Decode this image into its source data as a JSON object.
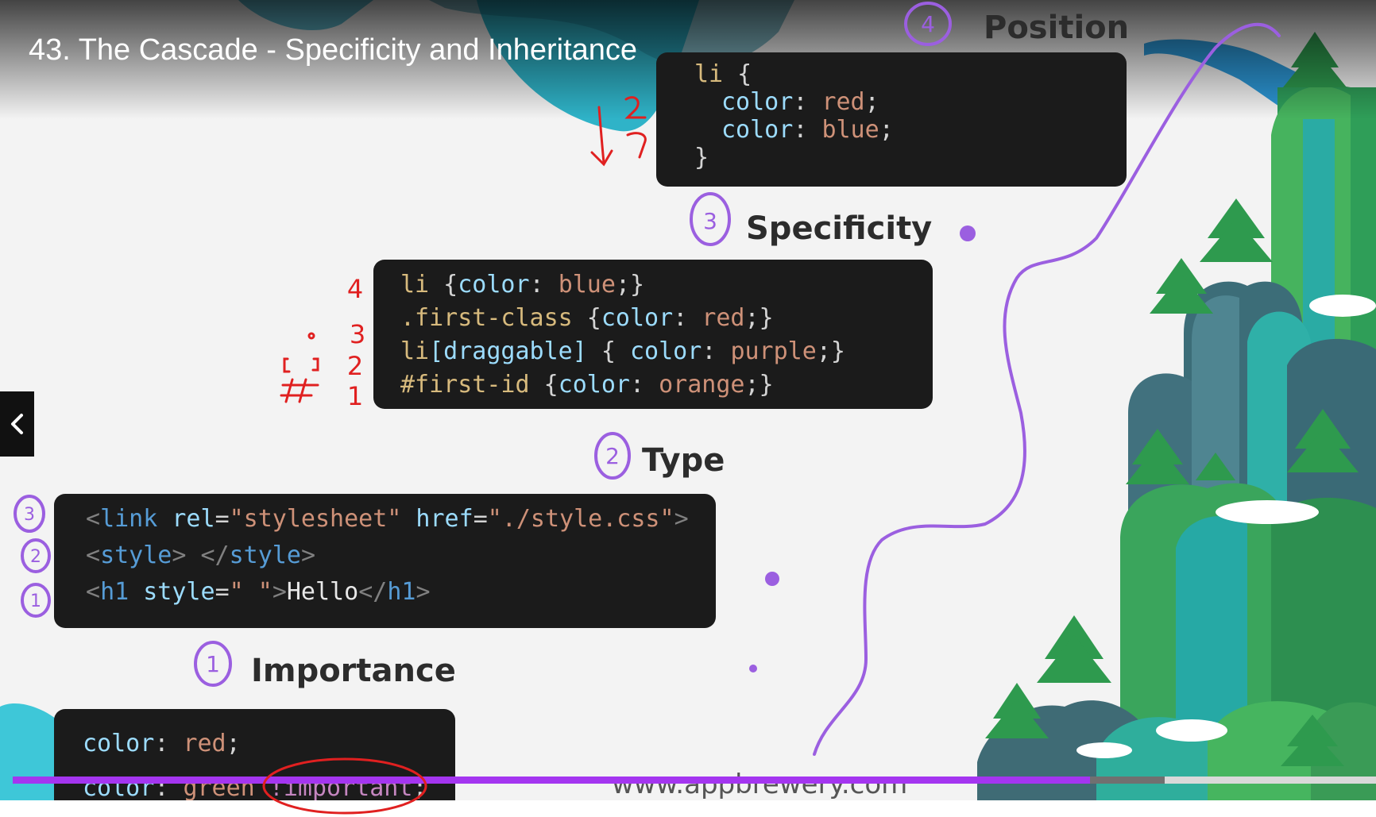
{
  "video": {
    "title": "43. The Cascade - Specificity and Inheritance",
    "watermark": "www.appbrewery.com",
    "progress_fraction": 0.79,
    "buffered_fraction": 0.845
  },
  "sections": {
    "position": {
      "heading": "Position",
      "number_annotation": "4",
      "code": {
        "line1_sel": "li",
        "line1_brace": " {",
        "line2_prop": "color",
        "line2_colon": ": ",
        "line2_val": "red",
        "line2_semi": ";",
        "line3_prop": "color",
        "line3_colon": ": ",
        "line3_val": "blue",
        "line3_semi": ";",
        "line4": "}"
      }
    },
    "specificity": {
      "heading": "Specificity",
      "number_annotation": "3",
      "code": [
        {
          "sel": "li",
          "open": " {",
          "prop": "color",
          "colon": ": ",
          "val": "blue",
          "close": ";}"
        },
        {
          "sel": ".first-class",
          "open": " {",
          "prop": "color",
          "colon": ": ",
          "val": "red",
          "close": ";}"
        },
        {
          "sel": "li",
          "attr": "[draggable]",
          "open": " { ",
          "prop": "color",
          "colon": ": ",
          "val": "purple",
          "close": ";}"
        },
        {
          "sel": "#first-id",
          "open": " {",
          "prop": "color",
          "colon": ": ",
          "val": "orange",
          "close": ";}"
        }
      ],
      "margin_notes": [
        "4",
        "3",
        "2",
        "1"
      ]
    },
    "type": {
      "heading": "Type",
      "number_annotation": "2",
      "code": {
        "l1_open": "<",
        "l1_tag": "link",
        "l1_a1": " rel",
        "l1_eq1": "=",
        "l1_v1": "\"stylesheet\"",
        "l1_a2": " href",
        "l1_eq2": "=",
        "l1_v2": "\"./style.css\"",
        "l1_close": ">",
        "l2_open": "<",
        "l2_tag": "style",
        "l2_mid": "> </",
        "l2_tag2": "style",
        "l2_close": ">",
        "l3_open": "<",
        "l3_tag": "h1",
        "l3_a1": " style",
        "l3_eq": "=",
        "l3_v1": "\" \"",
        "l3_gt": ">",
        "l3_text": "Hello",
        "l3_endopen": "</",
        "l3_tag2": "h1",
        "l3_close": ">"
      },
      "margin_numbers": [
        "3",
        "2",
        "1"
      ]
    },
    "importance": {
      "heading": "Importance",
      "number_annotation": "1",
      "code": {
        "l1_prop": "color",
        "l1_colon": ": ",
        "l1_val": "red",
        "l1_semi": ";",
        "l2_prop": "color",
        "l2_colon": ": ",
        "l2_val": "green ",
        "l2_imp": "!important",
        "l2_semi": ";"
      }
    }
  },
  "controls": {
    "prev_icon": "chevron-left-icon"
  },
  "colors": {
    "progress": "#a435f0",
    "annotation_purple": "#9b5fe0",
    "annotation_red": "#e02020"
  }
}
